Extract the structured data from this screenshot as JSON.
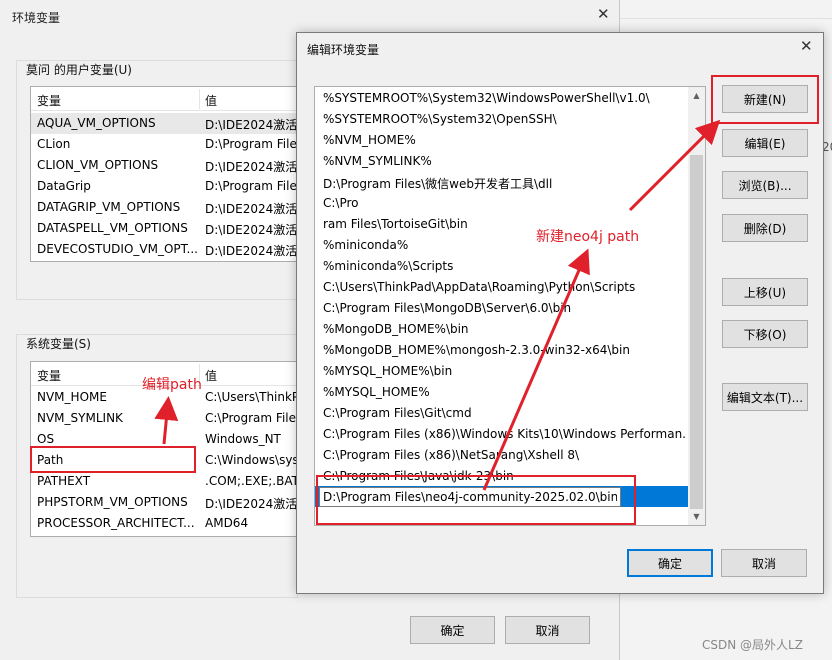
{
  "env_dialog": {
    "title": "环境变量",
    "close_glyph": "✕",
    "user_vars": {
      "group_label": "莫问 的用户变量(U)",
      "columns": [
        "变量",
        "值"
      ],
      "rows": [
        {
          "name": "AQUA_VM_OPTIONS",
          "value": "D:\\IDE2024激活"
        },
        {
          "name": "CLion",
          "value": "D:\\Program File"
        },
        {
          "name": "CLION_VM_OPTIONS",
          "value": "D:\\IDE2024激活"
        },
        {
          "name": "DataGrip",
          "value": "D:\\Program File"
        },
        {
          "name": "DATAGRIP_VM_OPTIONS",
          "value": "D:\\IDE2024激活"
        },
        {
          "name": "DATASPELL_VM_OPTIONS",
          "value": "D:\\IDE2024激活"
        },
        {
          "name": "DEVECOSTUDIO_VM_OPT...",
          "value": "D:\\IDE2024激活"
        }
      ]
    },
    "system_vars": {
      "group_label": "系统变量(S)",
      "columns": [
        "变量",
        "值"
      ],
      "rows": [
        {
          "name": "NVM_HOME",
          "value": "C:\\Users\\ThinkP"
        },
        {
          "name": "NVM_SYMLINK",
          "value": "C:\\Program File"
        },
        {
          "name": "OS",
          "value": "Windows_NT"
        },
        {
          "name": "Path",
          "value": "C:\\Windows\\sys"
        },
        {
          "name": "PATHEXT",
          "value": ".COM;.EXE;.BAT"
        },
        {
          "name": "PHPSTORM_VM_OPTIONS",
          "value": "D:\\IDE2024激活"
        },
        {
          "name": "PROCESSOR_ARCHITECT...",
          "value": "AMD64"
        }
      ]
    },
    "ok_label": "确定",
    "cancel_label": "取消"
  },
  "edit_dialog": {
    "title": "编辑环境变量",
    "close_glyph": "✕",
    "paths": [
      "%SYSTEMROOT%\\System32\\WindowsPowerShell\\v1.0\\",
      "%SYSTEMROOT%\\System32\\OpenSSH\\",
      "%NVM_HOME%",
      "%NVM_SYMLINK%",
      "D:\\Program Files\\微信web开发者工具\\dll",
      "C:\\Pro",
      "ram Files\\TortoiseGit\\bin",
      "%miniconda%",
      "%miniconda%\\Scripts",
      "C:\\Users\\ThinkPad\\AppData\\Roaming\\Python\\Scripts",
      "C:\\Program Files\\MongoDB\\Server\\6.0\\bin",
      "%MongoDB_HOME%\\bin",
      "%MongoDB_HOME%\\mongosh-2.3.0-win32-x64\\bin",
      "%MYSQL_HOME%\\bin",
      "%MYSQL_HOME%",
      "C:\\Program Files\\Git\\cmd",
      "C:\\Program Files (x86)\\Windows Kits\\10\\Windows Performan...",
      "C:\\Program Files (x86)\\NetSarang\\Xshell 8\\",
      "C:\\Program Files\\Java\\jdk-23\\bin"
    ],
    "editing_value": "D:\\Program Files\\neo4j-community-2025.02.0\\bin",
    "buttons": {
      "new": "新建(N)",
      "edit": "编辑(E)",
      "browse": "浏览(B)...",
      "delete": "删除(D)",
      "move_up": "上移(U)",
      "move_down": "下移(O)",
      "edit_text": "编辑文本(T)..."
    },
    "ok_label": "确定",
    "cancel_label": "取消"
  },
  "annotations": {
    "edit_path_note": "编辑path",
    "new_path_note": "新建neo4j path",
    "color": "#e0202a"
  },
  "background": {
    "fragment_text": "20"
  },
  "watermark": "CSDN @局外人LZ"
}
